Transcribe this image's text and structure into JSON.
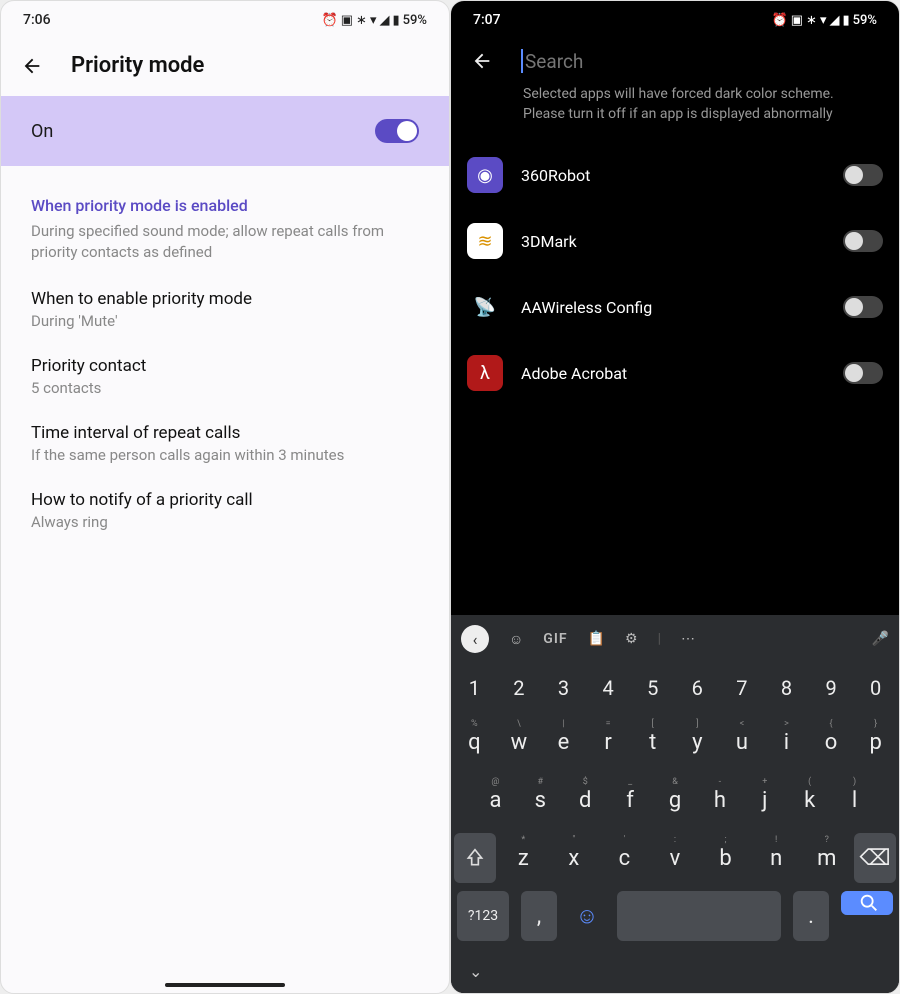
{
  "s1": {
    "status": {
      "time": "7:06",
      "battery": "59%"
    },
    "header": {
      "title": "Priority mode"
    },
    "toggle": {
      "label": "On",
      "state": "on"
    },
    "section": {
      "title": "When priority mode is enabled",
      "desc": "During specified sound mode; allow repeat calls from priority contacts as defined"
    },
    "items": [
      {
        "title": "When to enable priority mode",
        "sub": "During 'Mute'"
      },
      {
        "title": "Priority contact",
        "sub": "5 contacts"
      },
      {
        "title": "Time interval of repeat calls",
        "sub": "If the same person calls again within 3 minutes"
      },
      {
        "title": "How to notify of a priority call",
        "sub": "Always ring"
      }
    ]
  },
  "s2": {
    "status": {
      "time": "7:07",
      "battery": "59%"
    },
    "search": {
      "placeholder": "Search",
      "value": ""
    },
    "info": "Selected apps will have forced dark color scheme. Please turn it off if an app is displayed abnormally",
    "apps": [
      {
        "name": "360Robot",
        "icon": "◉",
        "color": "#5b4bc4",
        "state": "off"
      },
      {
        "name": "3DMark",
        "icon": "≋",
        "color": "#fff",
        "fg": "#d99100",
        "state": "off"
      },
      {
        "name": "AAWireless Config",
        "icon": "📡",
        "color": "transparent",
        "state": "off"
      },
      {
        "name": "Adobe Acrobat",
        "icon": "λ",
        "color": "#b11919",
        "state": "off"
      }
    ],
    "kb": {
      "toolbar": {
        "gif": "GIF"
      },
      "numrow": [
        "1",
        "2",
        "3",
        "4",
        "5",
        "6",
        "7",
        "8",
        "9",
        "0"
      ],
      "row1": [
        [
          "q",
          "%"
        ],
        [
          "w",
          "\\"
        ],
        [
          "e",
          "|"
        ],
        [
          "r",
          "="
        ],
        [
          "t",
          "["
        ],
        [
          "y",
          "]"
        ],
        [
          "u",
          "<"
        ],
        [
          "i",
          ">"
        ],
        [
          "o",
          "{"
        ],
        [
          "p",
          "}"
        ]
      ],
      "row2": [
        [
          "a",
          "@"
        ],
        [
          "s",
          "#"
        ],
        [
          "d",
          "$"
        ],
        [
          "f",
          "_"
        ],
        [
          "g",
          "&"
        ],
        [
          "h",
          "-"
        ],
        [
          "j",
          "+"
        ],
        [
          "k",
          "("
        ],
        [
          "l",
          ")"
        ]
      ],
      "row3": [
        [
          "z",
          "*"
        ],
        [
          "x",
          "\""
        ],
        [
          "c",
          "'"
        ],
        [
          "v",
          ":"
        ],
        [
          "b",
          ";"
        ],
        [
          "n",
          "!"
        ],
        [
          "m",
          "?"
        ]
      ],
      "row4": {
        "sym": "?123",
        "comma": ",",
        "period": "."
      }
    }
  }
}
